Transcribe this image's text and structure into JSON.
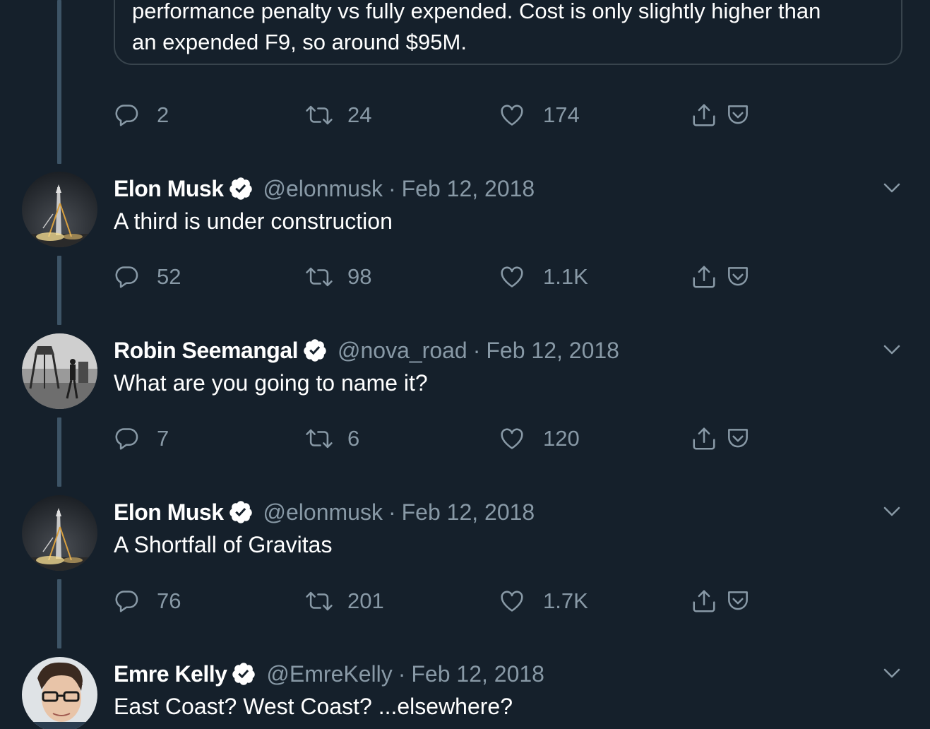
{
  "quoted_card": {
    "line1": "performance penalty vs fully expended. Cost is only slightly higher than",
    "line2": "an expended F9, so around $95M."
  },
  "top_actions": {
    "replies": "2",
    "retweets": "24",
    "likes": "174"
  },
  "tweets": [
    {
      "name": "Elon Musk",
      "handle": "@elonmusk",
      "sep": "·",
      "date": "Feb 12, 2018",
      "text": "A third is under construction",
      "replies": "52",
      "retweets": "98",
      "likes": "1.1K"
    },
    {
      "name": "Robin Seemangal",
      "handle": "@nova_road",
      "sep": "·",
      "date": "Feb 12, 2018",
      "text": "What are you going to name it?",
      "replies": "7",
      "retweets": "6",
      "likes": "120"
    },
    {
      "name": "Elon Musk",
      "handle": "@elonmusk",
      "sep": "·",
      "date": "Feb 12, 2018",
      "text": "A Shortfall of Gravitas",
      "replies": "76",
      "retweets": "201",
      "likes": "1.7K"
    },
    {
      "name": "Emre Kelly",
      "handle": "@EmreKelly",
      "sep": "·",
      "date": "Feb 12, 2018",
      "text": "East Coast? West Coast? ...elsewhere?"
    }
  ],
  "icons": {
    "reply": "reply-icon",
    "retweet": "retweet-icon",
    "like": "heart-icon",
    "share": "share-icon",
    "pocket": "pocket-icon",
    "verified": "verified-badge-icon",
    "more": "chevron-down-icon"
  },
  "colors": {
    "background": "#15202b",
    "secondary_text": "#8899a6",
    "thread_line": "#3d5466",
    "card_border": "#38444d"
  }
}
